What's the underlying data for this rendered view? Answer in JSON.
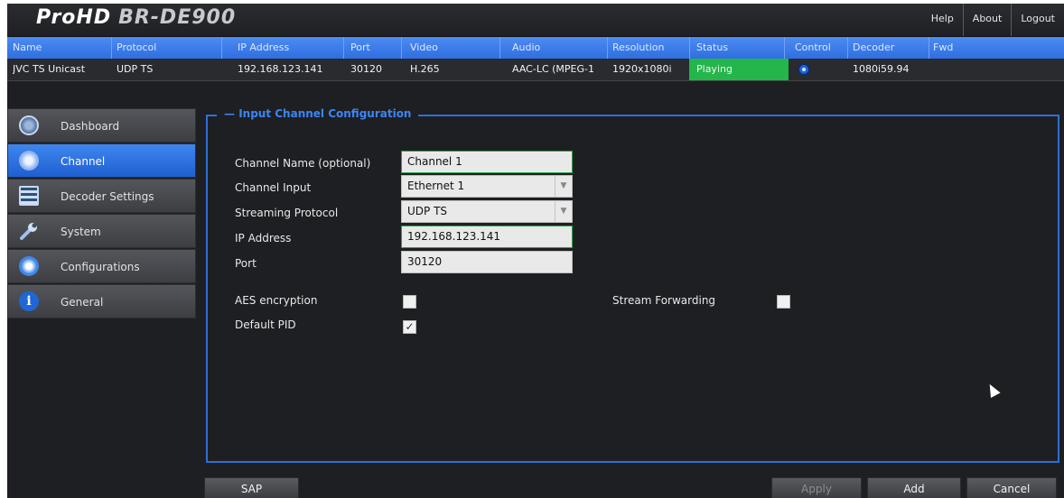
{
  "app": {
    "logo_prefix": "ProHD",
    "logo_model": "BR-DE900"
  },
  "header": {
    "links": [
      "Help",
      "About",
      "Logout"
    ]
  },
  "channel_table": {
    "columns": [
      "Name",
      "Protocol",
      "IP Address",
      "Port",
      "Video",
      "Audio",
      "Resolution",
      "Status",
      "Control",
      "Decoder",
      "Fwd"
    ],
    "row": {
      "name": "JVC TS Unicast",
      "protocol": "UDP TS",
      "ip": "192.168.123.141",
      "port": "30120",
      "video": "H.265",
      "audio": "AAC-LC (MPEG-1",
      "resolution": "1920x1080i",
      "status": "Playing",
      "control": "stop-button",
      "decoder": "1080i59.94",
      "fwd": ""
    },
    "status_color": "#24b64a",
    "header_color": "#3a7de8"
  },
  "sidebar": {
    "items": [
      {
        "label": "Dashboard",
        "icon": "dashboard-icon",
        "active": false
      },
      {
        "label": "Channel",
        "icon": "channel-icon",
        "active": true
      },
      {
        "label": "Decoder Settings",
        "icon": "decoder-settings-icon",
        "active": false
      },
      {
        "label": "System",
        "icon": "wrench-icon",
        "active": false
      },
      {
        "label": "Configurations",
        "icon": "gear-icon",
        "active": false
      },
      {
        "label": "General",
        "icon": "info-icon",
        "active": false
      }
    ]
  },
  "form": {
    "title": "Input Channel Configuration",
    "channel_name_label": "Channel Name (optional)",
    "channel_name_value": "Channel 1",
    "channel_input_label": "Channel Input",
    "channel_input_value": "Ethernet 1",
    "streaming_protocol_label": "Streaming Protocol",
    "streaming_protocol_value": "UDP TS",
    "ip_label": "IP Address",
    "ip_value": "192.168.123.141",
    "port_label": "Port",
    "port_value": "30120",
    "aes_label": "AES encryption",
    "aes_checked": false,
    "stream_forwarding_label": "Stream Forwarding",
    "stream_forwarding_checked": false,
    "default_pid_label": "Default PID",
    "default_pid_checked": true
  },
  "buttons": {
    "sap": "SAP",
    "apply": "Apply",
    "add": "Add",
    "cancel": "Cancel"
  },
  "colors": {
    "accent": "#2f6fd6",
    "active_field_border": "#25a244"
  }
}
